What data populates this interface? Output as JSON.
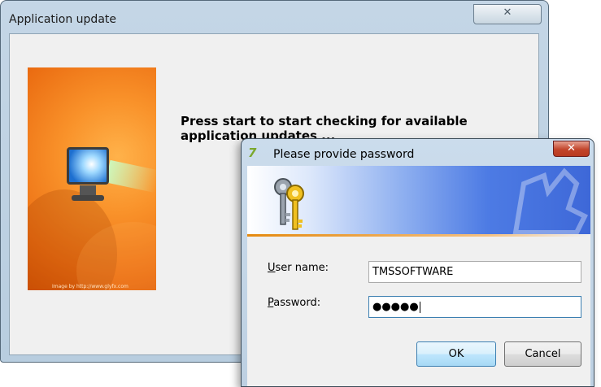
{
  "main_window": {
    "title": "Application update",
    "close_symbol": "✕",
    "message": "Press start to start checking for available application updates ...",
    "banner_credit": "Image by http://www.glyfx.com",
    "banner_icon": "monitor-icon"
  },
  "password_dialog": {
    "app_icon_glyph": "7",
    "title": "Please provide password",
    "close_symbol": "✕",
    "banner_icon": "keys-icon",
    "username": {
      "label_mnemonic": "U",
      "label_rest": "ser name:",
      "value": "TMSSOFTWARE"
    },
    "password": {
      "label_mnemonic": "P",
      "label_rest": "assword:",
      "value_masked": "●●●●●"
    },
    "ok_button": "OK",
    "cancel_button": "Cancel"
  },
  "colors": {
    "banner_orange": "#f9922a",
    "dialog_banner_blue": "#4d7be4",
    "close_red": "#c2442b",
    "focus_blue": "#3c7fb1"
  }
}
